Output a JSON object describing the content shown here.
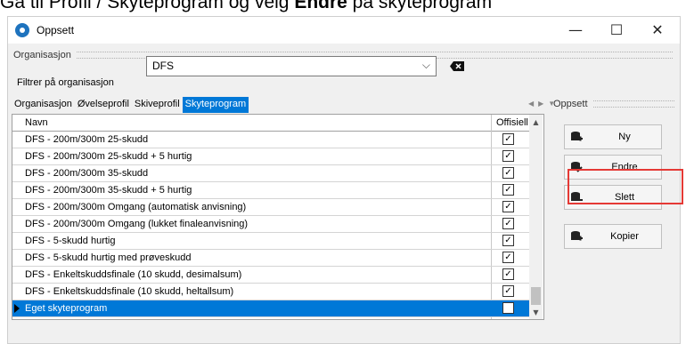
{
  "instruction": {
    "pre": "Gå til Profil / Skyteprogram og velg ",
    "bold": "Endre",
    "post": " på skyteprogram"
  },
  "window": {
    "title": "Oppsett",
    "minimize": "—",
    "maximize": "☐",
    "close": "✕"
  },
  "organisasjon_group": {
    "title": "Organisasjon"
  },
  "filter": {
    "label": "Filtrer på organisasjon",
    "value": "DFS",
    "dropdown_icon": "chevron-down-icon",
    "clear_icon": "backspace-icon"
  },
  "tabs": [
    {
      "label": "Organisasjon",
      "active": false
    },
    {
      "label": "Øvelseprofil",
      "active": false
    },
    {
      "label": "Skiveprofil",
      "active": false
    },
    {
      "label": "Skyteprogram",
      "active": true
    }
  ],
  "grid": {
    "columns": {
      "name": "Navn",
      "official": "Offisiell"
    },
    "rows": [
      {
        "name": "DFS - 200m/300m 25-skudd",
        "official": true
      },
      {
        "name": "DFS - 200m/300m 25-skudd + 5 hurtig",
        "official": true
      },
      {
        "name": "DFS - 200m/300m 35-skudd",
        "official": true
      },
      {
        "name": "DFS - 200m/300m 35-skudd + 5 hurtig",
        "official": true
      },
      {
        "name": "DFS - 200m/300m Omgang (automatisk anvisning)",
        "official": true
      },
      {
        "name": "DFS - 200m/300m Omgang (lukket finaleanvisning)",
        "official": true
      },
      {
        "name": "DFS - 5-skudd hurtig",
        "official": true
      },
      {
        "name": "DFS - 5-skudd hurtig med prøveskudd",
        "official": true
      },
      {
        "name": "DFS - Enkeltskuddsfinale (10 skudd, desimalsum)",
        "official": true
      },
      {
        "name": "DFS - Enkeltskuddsfinale (10 skudd, heltallsum)",
        "official": true
      },
      {
        "name": "Eget skyteprogram",
        "official": false,
        "selected": true
      }
    ]
  },
  "side_panel": {
    "title": "Oppsett",
    "buttons": [
      {
        "label": "Ny",
        "icon": "database-add-icon"
      },
      {
        "label": "Endre",
        "icon": "database-edit-icon"
      },
      {
        "label": "Slett",
        "icon": "database-delete-icon"
      },
      {
        "label": "Kopier",
        "icon": "database-copy-icon"
      }
    ]
  },
  "colors": {
    "accent": "#0078d7",
    "highlight": "#e53935"
  }
}
